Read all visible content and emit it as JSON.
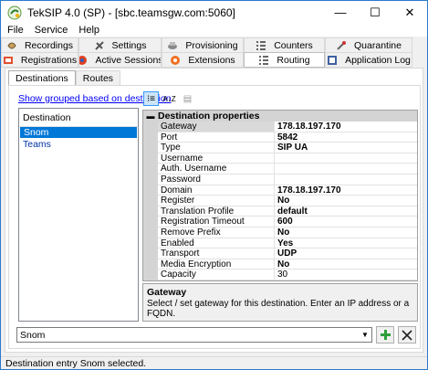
{
  "window": {
    "title": "TekSIP 4.0 (SP) - [sbc.teamsgw.com:5060]"
  },
  "window_controls": {
    "minimize": "—",
    "maximize": "☐",
    "close": "✕"
  },
  "menu": [
    {
      "label": "File"
    },
    {
      "label": "Service"
    },
    {
      "label": "Help"
    }
  ],
  "tabs_row1": [
    {
      "label": "Recordings",
      "icon": "recordings-icon"
    },
    {
      "label": "Settings",
      "icon": "settings-icon"
    },
    {
      "label": "Provisioning",
      "icon": "provisioning-icon"
    },
    {
      "label": "Counters",
      "icon": "counters-icon"
    },
    {
      "label": "Quarantine",
      "icon": "quarantine-icon"
    }
  ],
  "tabs_row2": [
    {
      "label": "Registrations",
      "icon": "registrations-icon"
    },
    {
      "label": "Active Sessions",
      "icon": "active-sessions-icon"
    },
    {
      "label": "Extensions",
      "icon": "extensions-icon"
    },
    {
      "label": "Routing",
      "icon": "routing-icon",
      "active": true
    },
    {
      "label": "Application Log",
      "icon": "application-log-icon"
    }
  ],
  "subtabs": [
    {
      "label": "Destinations",
      "active": true
    },
    {
      "label": "Routes"
    }
  ],
  "group_link": "Show grouped based on destination",
  "toolbar": {
    "categorized": "⁝≡",
    "alphabetical": "A↓Z",
    "pages": "▤"
  },
  "destinations": {
    "header": "Destination",
    "items": [
      {
        "label": "Snom",
        "selected": true
      },
      {
        "label": "Teams"
      }
    ]
  },
  "properties": {
    "category": "Destination properties",
    "rows": [
      {
        "name": "Gateway",
        "value": "178.18.197.170",
        "selected": true
      },
      {
        "name": "Port",
        "value": "5842"
      },
      {
        "name": "Type",
        "value": "SIP UA"
      },
      {
        "name": "Username",
        "value": ""
      },
      {
        "name": "Auth. Username",
        "value": ""
      },
      {
        "name": "Password",
        "value": ""
      },
      {
        "name": "Domain",
        "value": "178.18.197.170"
      },
      {
        "name": "Register",
        "value": "No"
      },
      {
        "name": "Translation Profile",
        "value": "default"
      },
      {
        "name": "Registration Timeout",
        "value": "600"
      },
      {
        "name": "Remove Prefix",
        "value": "No"
      },
      {
        "name": "Enabled",
        "value": "Yes"
      },
      {
        "name": "Transport",
        "value": "UDP"
      },
      {
        "name": "Media Encryption",
        "value": "No"
      },
      {
        "name": "Capacity",
        "value": "30",
        "normal": true
      }
    ]
  },
  "help": {
    "title": "Gateway",
    "description": "Select / set gateway for this destination. Enter an IP address or a FQDN."
  },
  "combo": {
    "value": "Snom"
  },
  "status": "Destination entry Snom selected.",
  "colors": {
    "accent": "#0078d7",
    "add_green": "#2e9e3a",
    "title_border": "#2b79d0"
  }
}
